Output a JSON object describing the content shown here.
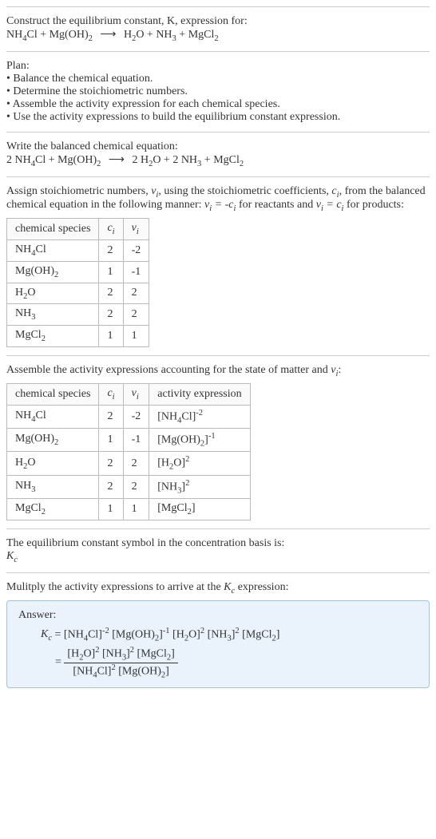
{
  "header": {
    "line1": "Construct the equilibrium constant, K, expression for:",
    "eq_lhs1": "NH",
    "eq_lhs2": "Cl + Mg(OH)",
    "eq_rhs1": "H",
    "eq_rhs2": "O + NH",
    "eq_rhs3": " + MgCl"
  },
  "plan": {
    "title": "Plan:",
    "b1": "• Balance the chemical equation.",
    "b2": "• Determine the stoichiometric numbers.",
    "b3": "• Assemble the activity expression for each chemical species.",
    "b4": "• Use the activity expressions to build the equilibrium constant expression."
  },
  "balanced": {
    "title": "Write the balanced chemical equation:",
    "lhs1": "2 NH",
    "lhs2": "Cl + Mg(OH)",
    "rhs1": "2 H",
    "rhs2": "O + 2 NH",
    "rhs3": " + MgCl"
  },
  "stoich": {
    "intro1": "Assign stoichiometric numbers, ",
    "intro2": ", using the stoichiometric coefficients, ",
    "intro3": ", from the balanced chemical equation in the following manner: ",
    "intro4": " for reactants and ",
    "intro5": " for products:",
    "h1": "chemical species",
    "h2": "c",
    "h3": "ν",
    "r1c1a": "NH",
    "r1c1b": "Cl",
    "r1c2": "2",
    "r1c3": "-2",
    "r2c1": "Mg(OH)",
    "r2c2": "1",
    "r2c3": "-1",
    "r3c1a": "H",
    "r3c1b": "O",
    "r3c2": "2",
    "r3c3": "2",
    "r4c1": "NH",
    "r4c2": "2",
    "r4c3": "2",
    "r5c1": "MgCl",
    "r5c2": "1",
    "r5c3": "1"
  },
  "activity": {
    "title": "Assemble the activity expressions accounting for the state of matter and ",
    "title2": ":",
    "h1": "chemical species",
    "h2": "c",
    "h3": "ν",
    "h4": "activity expression",
    "r1c1a": "NH",
    "r1c1b": "Cl",
    "r1c2": "2",
    "r1c3": "-2",
    "r1c4a": "[NH",
    "r1c4b": "Cl]",
    "r1c4exp": "-2",
    "r2c1": "Mg(OH)",
    "r2c2": "1",
    "r2c3": "-1",
    "r2c4a": "[Mg(OH)",
    "r2c4b": "]",
    "r2c4exp": "-1",
    "r3c1a": "H",
    "r3c1b": "O",
    "r3c2": "2",
    "r3c3": "2",
    "r3c4a": "[H",
    "r3c4b": "O]",
    "r3c4exp": "2",
    "r4c1": "NH",
    "r4c2": "2",
    "r4c3": "2",
    "r4c4a": "[NH",
    "r4c4b": "]",
    "r4c4exp": "2",
    "r5c1": "MgCl",
    "r5c2": "1",
    "r5c3": "1",
    "r5c4a": "[MgCl",
    "r5c4b": "]"
  },
  "symbol": {
    "line1": "The equilibrium constant symbol in the concentration basis is:",
    "sym": "K"
  },
  "mult": {
    "line": "Mulitply the activity expressions to arrive at the ",
    "line2": " expression:"
  },
  "answer": {
    "label": "Answer:",
    "kc": "K",
    "eq1a": "[NH",
    "eq1b": "Cl]",
    "eq1exp": "-2",
    "eq2a": "[Mg(OH)",
    "eq2b": "]",
    "eq2exp": "-1",
    "eq3a": "[H",
    "eq3b": "O]",
    "eq3exp": "2",
    "eq4a": "[NH",
    "eq4b": "]",
    "eq4exp": "2",
    "eq5a": "[MgCl",
    "eq5b": "]",
    "numA": "[H",
    "numB": "O]",
    "numExp1": "2",
    "numC": "[NH",
    "numD": "]",
    "numExp2": "2",
    "numE": "[MgCl",
    "numF": "]",
    "denA": "[NH",
    "denB": "Cl]",
    "denExp1": "2",
    "denC": "[Mg(OH)",
    "denD": "]"
  }
}
